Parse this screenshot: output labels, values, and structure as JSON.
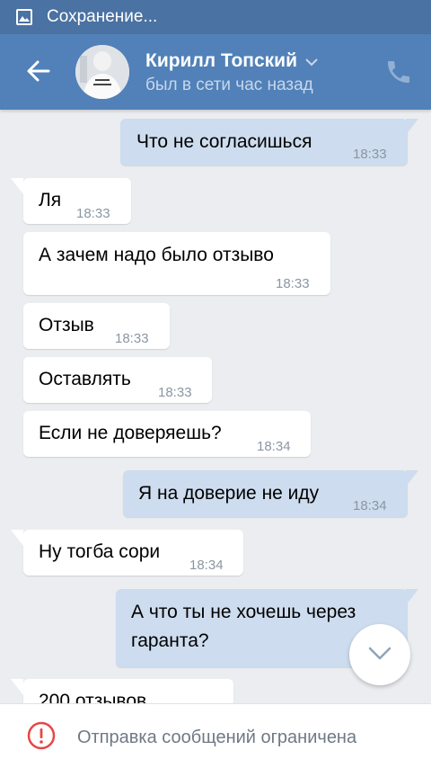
{
  "status_bar": {
    "text": "Сохранение...",
    "icon": "image-icon"
  },
  "header": {
    "name": "Кирилл Топский",
    "status": "был в сети час назад",
    "icons": [
      "back-arrow-icon",
      "chevron-down-icon",
      "phone-icon"
    ],
    "colors": {
      "bar": "#5181b8",
      "status_bar": "#4a72a2"
    }
  },
  "messages": [
    {
      "dir": "out",
      "text": "Что не согласишься",
      "time": "18:33"
    },
    {
      "dir": "in",
      "text": "Ля",
      "time": "18:33"
    },
    {
      "dir": "in",
      "text": "А зачем надо было отзыво",
      "time": "18:33"
    },
    {
      "dir": "in",
      "text": "Отзыв",
      "time": "18:33"
    },
    {
      "dir": "in",
      "text": "Оставлять",
      "time": "18:33"
    },
    {
      "dir": "in",
      "text": "Если не доверяешь?",
      "time": "18:34"
    },
    {
      "dir": "out",
      "text": "Я на доверие не иду",
      "time": "18:34"
    },
    {
      "dir": "in",
      "text": "Ну тогба сори",
      "time": "18:34"
    },
    {
      "dir": "out",
      "text": "А что ты не хочешь через гаранта?",
      "line1": "А что ты не хочешь через",
      "line2": "гаранта?",
      "time": ""
    },
    {
      "dir": "in",
      "text": "200 отзывов",
      "time": ""
    }
  ],
  "scroll_button": {
    "icon": "chevron-down-icon"
  },
  "footer": {
    "text": "Отправка сообщений ограничена",
    "icon": "exclamation-circle-icon",
    "icon_color": "#e64646"
  }
}
